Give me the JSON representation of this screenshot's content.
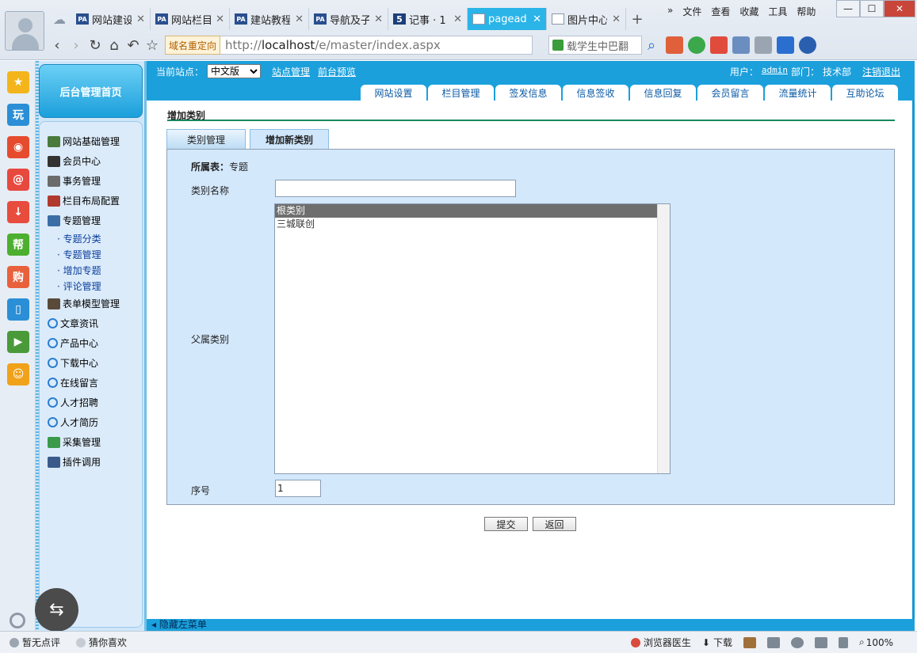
{
  "browser": {
    "tabs": [
      {
        "label": "网站建设",
        "icon": "PA"
      },
      {
        "label": "网站栏目",
        "icon": "PA"
      },
      {
        "label": "建站教程",
        "icon": "PA"
      },
      {
        "label": "导航及子",
        "icon": "PA"
      },
      {
        "label": "记事 · 1",
        "icon": "5"
      },
      {
        "label": "pagead",
        "icon": ""
      },
      {
        "label": "图片中心",
        "icon": ""
      }
    ],
    "active_tab": 5,
    "top_menu": [
      "文件",
      "查看",
      "收藏",
      "工具",
      "帮助"
    ],
    "redirect_label": "域名重定向",
    "url_scheme": "http://",
    "url_host": "localhost",
    "url_path": "/e/master/index.aspx",
    "search_text": "载学生中巴翻"
  },
  "app": {
    "home_button": "后台管理首页",
    "site_label": "当前站点：",
    "site_selected": "中文版",
    "site_manage_link": "站点管理",
    "front_preview_link": "前台预览",
    "user_label": "用户：",
    "user_name": "admin",
    "dept_label": "部门：",
    "dept_name": "技术部",
    "logout": "注销退出",
    "main_tabs": [
      "网站设置",
      "栏目管理",
      "签发信息",
      "信息签收",
      "信息回复",
      "会员留言",
      "流量统计",
      "互助论坛"
    ]
  },
  "nav": {
    "items": [
      {
        "label": "网站基础管理",
        "color": "#4a7a3c"
      },
      {
        "label": "会员中心",
        "color": "#333333"
      },
      {
        "label": "事务管理",
        "color": "#6b6b6b"
      },
      {
        "label": "栏目布局配置",
        "color": "#b03a2e"
      },
      {
        "label": "专题管理",
        "color": "#3a6ea5"
      }
    ],
    "sub_items": [
      "· 专题分类",
      "· 专题管理",
      "· 增加专题",
      "· 评论管理"
    ],
    "items2": [
      {
        "label": "表单模型管理",
        "icon": "book"
      },
      {
        "label": "文章资讯",
        "icon": "ie"
      },
      {
        "label": "产品中心",
        "icon": "ie"
      },
      {
        "label": "下载中心",
        "icon": "ie"
      },
      {
        "label": "在线留言",
        "icon": "ie"
      },
      {
        "label": "人才招聘",
        "icon": "ie"
      },
      {
        "label": "人才简历",
        "icon": "ie"
      },
      {
        "label": "采集管理",
        "icon": "globe"
      },
      {
        "label": "插件调用",
        "icon": "pc"
      }
    ]
  },
  "content": {
    "title": "增加类别",
    "form_tabs": [
      "类别管理",
      "增加新类别"
    ],
    "active_form_tab": 1,
    "table_label": "所属表：",
    "table_value": "专题",
    "name_label": "类别名称",
    "name_value": "",
    "parent_label": "父属类别",
    "parent_options": [
      "根类别",
      "三城联创"
    ],
    "parent_selected": 0,
    "seq_label": "序号",
    "seq_value": "1",
    "submit_label": "提交",
    "back_label": "返回",
    "hide_menu": "隐藏左菜单"
  },
  "statusbar": {
    "left1": "暂无点评",
    "left2": "猜你喜欢",
    "doctor": "浏览器医生",
    "download": "下载",
    "zoom": "100%"
  },
  "sidebar_icons": [
    {
      "name": "favorites-icon",
      "color": "#f3b51b",
      "glyph": "★"
    },
    {
      "name": "play-icon",
      "color": "#2a8fd6",
      "glyph": "玩"
    },
    {
      "name": "weibo-icon",
      "color": "#e64b2e",
      "glyph": "◉"
    },
    {
      "name": "mail-icon",
      "color": "#e8493f",
      "glyph": "@"
    },
    {
      "name": "download-app-icon",
      "color": "#e84c3d",
      "glyph": "↓"
    },
    {
      "name": "help-icon",
      "color": "#4caf2f",
      "glyph": "帮"
    },
    {
      "name": "shop-icon",
      "color": "#e8603c",
      "glyph": "购"
    },
    {
      "name": "book-icon",
      "color": "#2a8fd6",
      "glyph": "▯"
    },
    {
      "name": "video-icon",
      "color": "#4a9a3a",
      "glyph": "▶"
    },
    {
      "name": "emoji-icon",
      "color": "#f0a21b",
      "glyph": "☺"
    }
  ]
}
